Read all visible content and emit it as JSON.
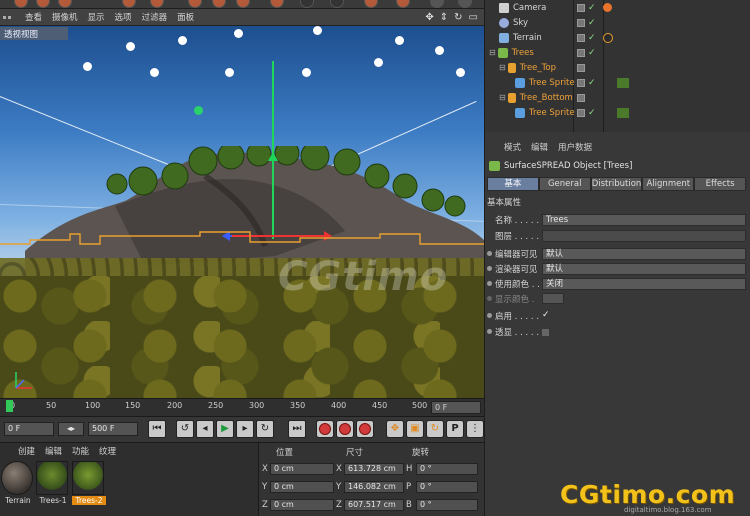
{
  "viewport": {
    "menu": [
      "查看",
      "摄像机",
      "显示",
      "选项",
      "过滤器",
      "面板"
    ],
    "label": "透视视图",
    "watermark": "CGtimo"
  },
  "objects": [
    {
      "name": "Camera",
      "icon": "camera-icon",
      "color": "#cfcfcf"
    },
    {
      "name": "Sky",
      "icon": "sky-icon",
      "color": "#cfcfcf"
    },
    {
      "name": "Terrain",
      "icon": "terrain-icon",
      "color": "#cfcfcf"
    },
    {
      "name": "Trees",
      "icon": "surface-spread-icon",
      "color": "#f0a23a"
    },
    {
      "name": "Tree_Top",
      "icon": "null-icon",
      "color": "#f0a23a"
    },
    {
      "name": "Tree Sprite",
      "icon": "sprite-icon",
      "color": "#f0a23a"
    },
    {
      "name": "Tree_Bottom",
      "icon": "null-icon",
      "color": "#f0a23a"
    },
    {
      "name": "Tree Sprite",
      "icon": "sprite-icon",
      "color": "#f0a23a"
    }
  ],
  "attributes": {
    "menu": [
      "模式",
      "编辑",
      "用户数据"
    ],
    "title": "SurfaceSPREAD Object [Trees]",
    "tabs": [
      "基本",
      "General",
      "Distribution",
      "Alignment",
      "Effects"
    ],
    "section": "基本属性",
    "props": [
      {
        "label": "名称 . . . . .",
        "value": "Trees"
      },
      {
        "label": "图层 . . . . .",
        "value": ""
      },
      {
        "label": "编辑器可见",
        "value": "默认"
      },
      {
        "label": "渲染器可见",
        "value": "默认"
      },
      {
        "label": "使用颜色 . .",
        "value": "关闭"
      },
      {
        "label": "显示颜色 .",
        "value": ""
      },
      {
        "label": "启用 . . . . .",
        "value": "✓"
      },
      {
        "label": "透显 . . . . .",
        "value": ""
      }
    ]
  },
  "timeline": {
    "ticks": [
      "0",
      "50",
      "100",
      "150",
      "200",
      "250",
      "300",
      "350",
      "400",
      "450",
      "500"
    ],
    "end_field": "0 F"
  },
  "transport": {
    "start": "0 F",
    "end": "500 F"
  },
  "materials": {
    "menu": [
      "创建",
      "编辑",
      "功能",
      "纹理"
    ],
    "items": [
      "Terrain",
      "Trees-1",
      "Trees-2"
    ]
  },
  "coords": {
    "headers": [
      "位置",
      "尺寸",
      "旋转"
    ],
    "rows": [
      {
        "axis": "X",
        "pos": "0 cm",
        "size": "613.728 cm",
        "rot_axis": "H",
        "rot": "0 °"
      },
      {
        "axis": "Y",
        "pos": "0 cm",
        "size": "146.082 cm",
        "rot_axis": "P",
        "rot": "0 °"
      },
      {
        "axis": "Z",
        "pos": "0 cm",
        "size": "607.517 cm",
        "rot_axis": "B",
        "rot": "0 °"
      }
    ]
  },
  "brand": {
    "name": "CGtimo.com",
    "url": "digitaltimo.blog.163.com"
  }
}
